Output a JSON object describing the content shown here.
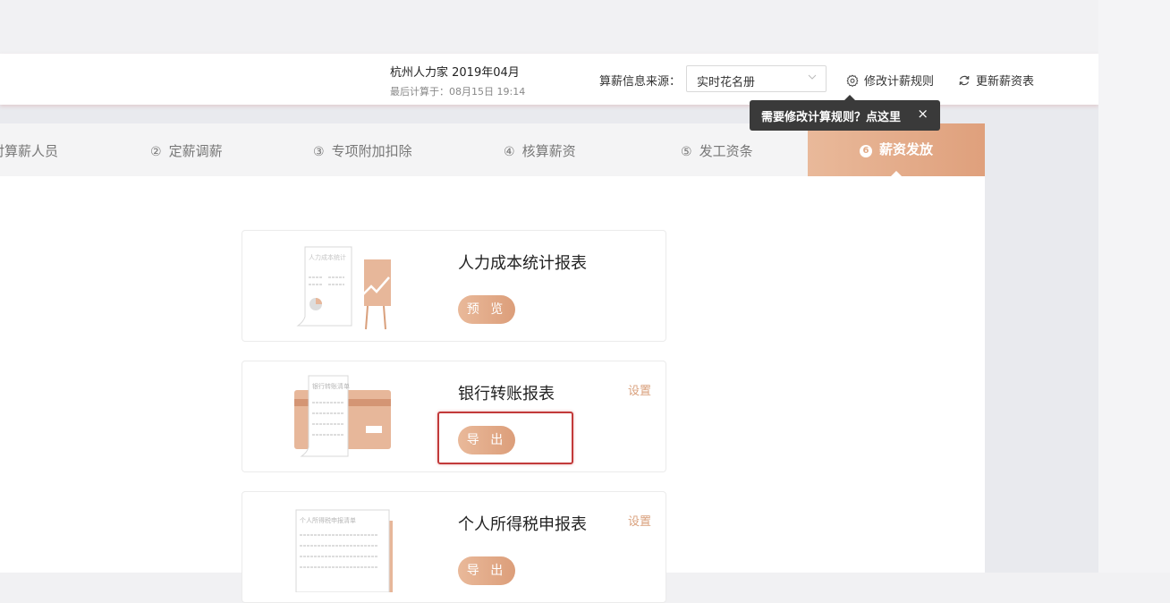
{
  "header": {
    "company_period": "杭州人力家 2019年04月",
    "last_calc": "最后计算于：08月15日 19:14",
    "source_label": "算薪信息来源：",
    "source_value": "实时花名册",
    "modify_rules": "修改计薪规则",
    "refresh_table": "更新薪资表"
  },
  "tooltip": {
    "text": "需要修改计算规则？点这里",
    "close": "×"
  },
  "steps": [
    {
      "num": "",
      "label": "对算薪人员"
    },
    {
      "num": "②",
      "label": "定薪调薪"
    },
    {
      "num": "③",
      "label": "专项附加扣除"
    },
    {
      "num": "④",
      "label": "核算薪资"
    },
    {
      "num": "⑤",
      "label": "发工资条"
    },
    {
      "num": "6",
      "label": "薪资发放"
    }
  ],
  "reports": [
    {
      "title": "人力成本统计报表",
      "button": "预 览",
      "setting": "",
      "doc_label": "人力成本统计"
    },
    {
      "title": "银行转账报表",
      "button": "导 出",
      "setting": "设置",
      "doc_label": "银行转账清单"
    },
    {
      "title": "个人所得税申报表",
      "button": "导 出",
      "setting": "设置",
      "doc_label": "个人所得税申报清单"
    }
  ],
  "colors": {
    "accent": "#dfa07c",
    "highlight": "#c23a3a"
  },
  "icons": {
    "modify": "gear-icon",
    "refresh": "refresh-icon",
    "select": "chevron-down-icon"
  }
}
